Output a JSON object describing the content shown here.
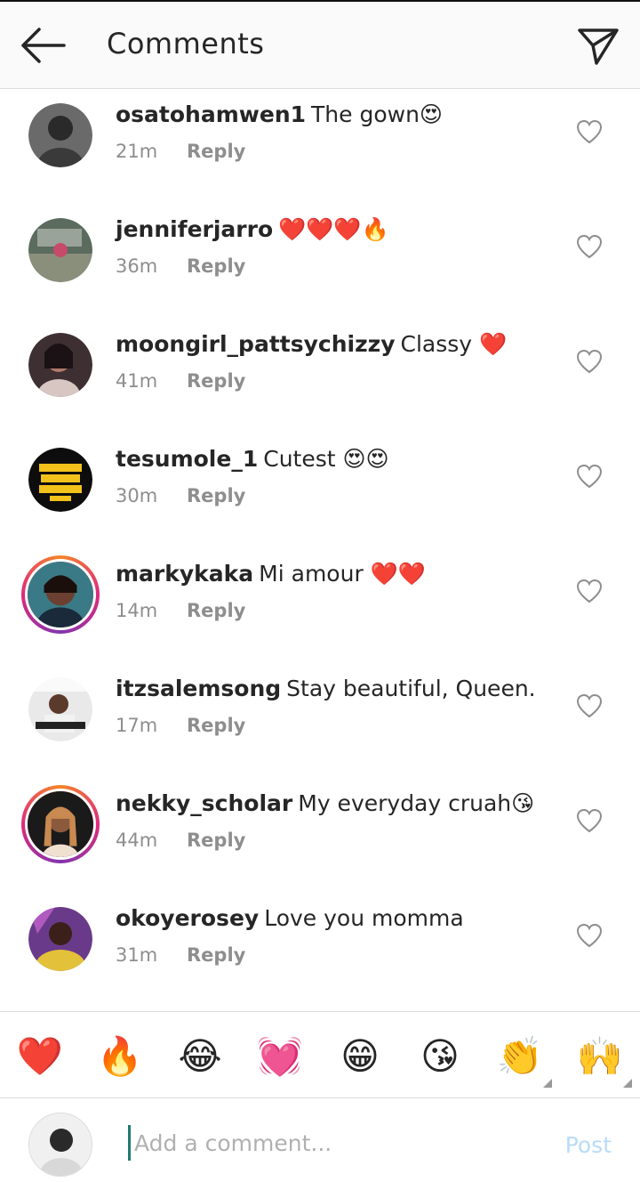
{
  "header": {
    "title": "Comments",
    "back_icon": "arrow-left-icon",
    "send_icon": "paper-plane-icon"
  },
  "comments": [
    {
      "username": "osatohamwen1",
      "text": "The gown😍",
      "time": "21m",
      "reply": "Reply",
      "story_ring": false
    },
    {
      "username": "jenniferjarro",
      "text": "❤️❤️❤️🔥",
      "time": "36m",
      "reply": "Reply",
      "story_ring": false
    },
    {
      "username": "moongirl_pattsychizzy",
      "text": "Classy ❤️",
      "time": "41m",
      "reply": "Reply",
      "story_ring": false
    },
    {
      "username": "tesumole_1",
      "text": "Cutest 😍😍",
      "time": "30m",
      "reply": "Reply",
      "story_ring": false
    },
    {
      "username": "markykaka",
      "text": "Mi amour ❤️❤️",
      "time": "14m",
      "reply": "Reply",
      "story_ring": true
    },
    {
      "username": "itzsalemsong",
      "text": "Stay beautiful, Queen.",
      "time": "17m",
      "reply": "Reply",
      "story_ring": false
    },
    {
      "username": "nekky_scholar",
      "text": "My everyday cruah😘",
      "time": "44m",
      "reply": "Reply",
      "story_ring": true
    },
    {
      "username": "okoyerosey",
      "text": "Love you momma",
      "time": "31m",
      "reply": "Reply",
      "story_ring": false
    }
  ],
  "emoji_bar": [
    "❤️",
    "🔥",
    "😂",
    "💓",
    "😁",
    "😘",
    "👏",
    "🙌"
  ],
  "composer": {
    "placeholder": "Add a comment...",
    "post_label": "Post"
  },
  "colors": {
    "post_disabled": "#b8dcf7",
    "story_ring_start": "#f58529",
    "story_ring_end": "#dd2a7b"
  }
}
